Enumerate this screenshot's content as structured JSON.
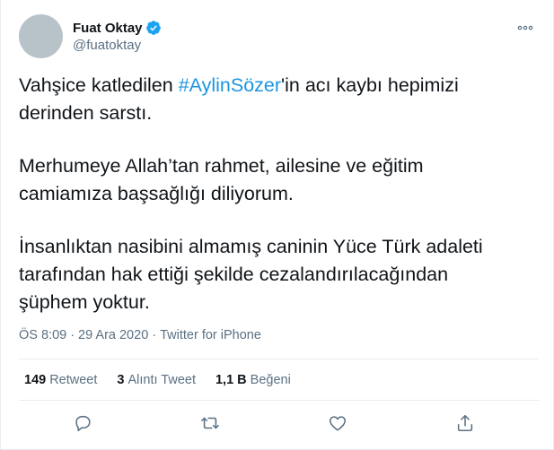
{
  "author": {
    "name": "Fuat Oktay",
    "handle": "@fuatoktay"
  },
  "tweet": {
    "p1_before": "Vahşice katledilen ",
    "p1_hashtag": "#AylinSözer",
    "p1_after": "'in acı kaybı hepimizi derinden sarstı.",
    "p2": "Merhumeye Allah’tan rahmet, ailesine ve eğitim camiamıza başsağlığı diliyorum.",
    "p3": "İnsanlıktan nasibini almamış caninin Yüce Türk adaleti tarafından hak ettiği şekilde cezalandırılacağından şüphem yoktur."
  },
  "meta": {
    "time": "ÖS 8:09",
    "date": "29 Ara 2020",
    "source": "Twitter for iPhone",
    "dot": "·"
  },
  "stats": {
    "retweets_count": "149",
    "retweets_label": "Retweet",
    "quotes_count": "3",
    "quotes_label": "Alıntı Tweet",
    "likes_count": "1,1 B",
    "likes_label": "Beğeni"
  },
  "icons": {
    "verified": "verified-badge-icon",
    "more": "more-options-icon",
    "reply": "reply-icon",
    "retweet": "retweet-icon",
    "like": "heart-icon",
    "share": "share-icon"
  },
  "colors": {
    "accent": "#1da1f2",
    "hashtag": "#1b95e0",
    "muted": "#5b7083"
  }
}
